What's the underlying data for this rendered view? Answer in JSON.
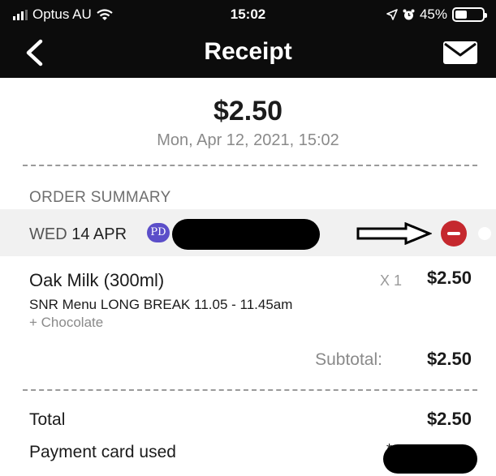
{
  "status_bar": {
    "carrier": "Optus AU",
    "time": "15:02",
    "battery": "45%",
    "battery_level": 0.45
  },
  "nav": {
    "title": "Receipt",
    "back_icon": "chevron-left-icon",
    "mail_icon": "envelope-icon"
  },
  "receipt": {
    "amount": "$2.50",
    "datetime": "Mon, Apr 12, 2021, 15:02"
  },
  "order_summary": {
    "section_label": "ORDER SUMMARY",
    "day_prefix": "WED",
    "day_date": "14 APR",
    "badge": "PD",
    "remove_color": "#c5282e",
    "items": [
      {
        "name": "Oak Milk (300ml)",
        "qty": "X 1",
        "price": "$2.50",
        "menu": "SNR Menu LONG BREAK 11.05 - 11.45am",
        "modifier": "+ Chocolate"
      }
    ],
    "subtotal_label": "Subtotal:",
    "subtotal_value": "$2.50"
  },
  "totals": {
    "total_label": "Total",
    "total_value": "$2.50",
    "payment_label": "Payment card used",
    "payment_value": "*"
  }
}
